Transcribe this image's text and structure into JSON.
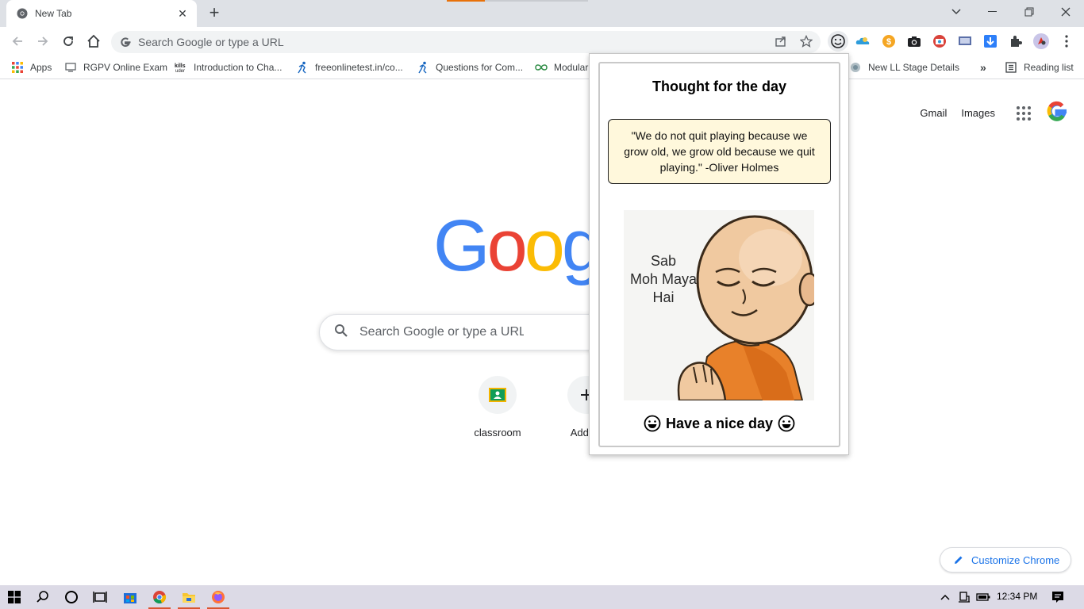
{
  "browser": {
    "tab": {
      "title": "New Tab"
    },
    "omnibox": {
      "placeholder": "Search Google or type a URL"
    },
    "bookmarks": [
      {
        "label": "Apps",
        "icon": "apps-grid-icon"
      },
      {
        "label": "RGPV Online Exam",
        "icon": "monitor-icon"
      },
      {
        "label": "Introduction to Cha...",
        "icon": "skills-icon"
      },
      {
        "label": "freeonlinetest.in/co...",
        "icon": "runner-icon"
      },
      {
        "label": "Questions for Com...",
        "icon": "runner-icon"
      },
      {
        "label": "Modular",
        "icon": "infinity-icon"
      },
      {
        "label": "New LL Stage Details",
        "icon": "site-icon"
      }
    ],
    "bookmarks_overflow": "»",
    "reading_list": "Reading list"
  },
  "ntp": {
    "gmail": "Gmail",
    "images": "Images",
    "logo_visible": "Goog",
    "search_placeholder": "Search Google or type a URL",
    "shortcuts": [
      {
        "label": "classroom"
      },
      {
        "label": "Add sh"
      }
    ],
    "customize": "Customize Chrome"
  },
  "popup": {
    "title": "Thought for the day",
    "quote": "\"We do not quit playing because we grow old, we grow old because we quit playing.\" -Oliver Holmes",
    "image_text": [
      "Sab",
      "Moh Maya",
      "Hai"
    ],
    "footer": "Have a nice day"
  },
  "taskbar": {
    "time": "12:34 PM"
  },
  "colors": {
    "google_blue": "#4285f4",
    "google_red": "#ea4335",
    "google_yellow": "#fbbc05",
    "google_green": "#34a853",
    "quote_bg": "#fff8dc",
    "monk_robe": "#e8812a"
  }
}
